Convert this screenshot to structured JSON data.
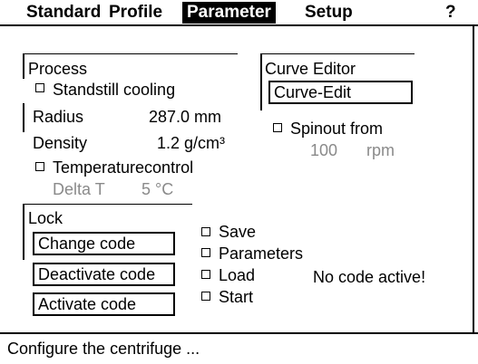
{
  "tabs": [
    {
      "label": "Standard",
      "active": false
    },
    {
      "label": "Profile",
      "active": false
    },
    {
      "label": "Parameter",
      "active": true
    },
    {
      "label": "Setup",
      "active": false
    }
  ],
  "help_label": "?",
  "process": {
    "title": "Process",
    "standstill_cooling": {
      "label": "Standstill cooling",
      "checked": false
    },
    "radius": {
      "label": "Radius",
      "value": "287.0 mm"
    },
    "density": {
      "label": "Density",
      "value": "1.2 g/cm³"
    },
    "temperature_control": {
      "label": "Temperaturecontrol",
      "checked": false
    },
    "delta_t": {
      "label": "Delta T",
      "value": "5 °C"
    }
  },
  "curve_editor": {
    "title": "Curve Editor",
    "button_label": "Curve-Edit",
    "spinout": {
      "label": "Spinout from",
      "checked": false,
      "value": "100",
      "unit": "rpm"
    }
  },
  "lock": {
    "title": "Lock",
    "buttons": {
      "change": "Change code",
      "deactivate": "Deactivate code",
      "activate": "Activate code"
    },
    "options": [
      {
        "label": "Save",
        "checked": false
      },
      {
        "label": "Parameters",
        "checked": false
      },
      {
        "label": "Load",
        "checked": false
      },
      {
        "label": "Start",
        "checked": false
      }
    ],
    "status_text": "No code active!"
  },
  "status_bar": {
    "text": "Configure the centrifuge ..."
  },
  "colors": {
    "foreground": "#000000",
    "background": "#ffffff",
    "disabled_text": "#8a8a8a"
  }
}
